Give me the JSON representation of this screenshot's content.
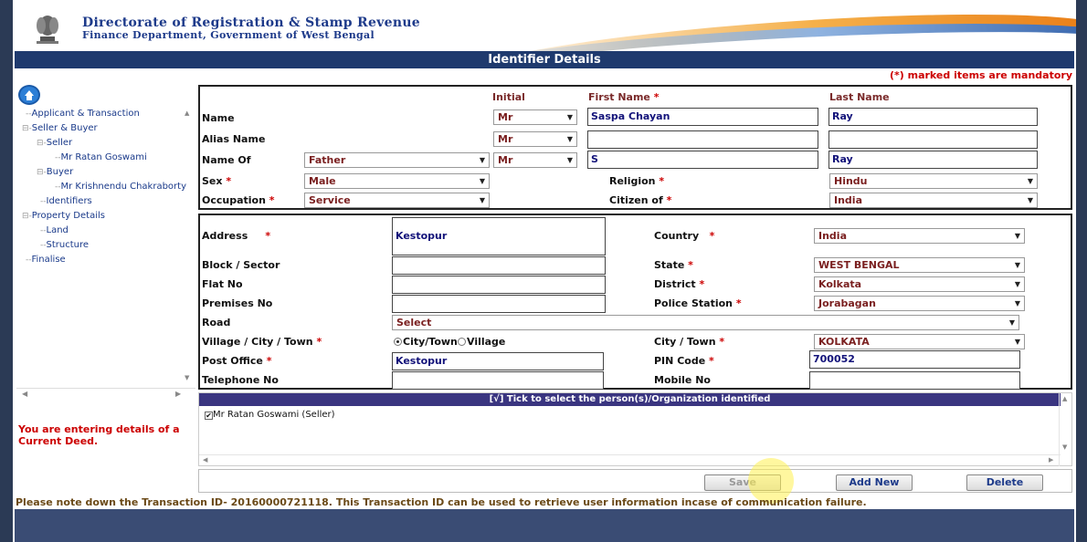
{
  "header": {
    "title": "Directorate of Registration & Stamp Revenue",
    "subtitle": "Finance Department, Government of West Bengal",
    "emblem_text": "सत्यमेव जयते"
  },
  "page_title": "Identifier Details",
  "mandatory_note": "(*) marked items are mandatory",
  "tree": [
    {
      "label": "Applicant & Transaction",
      "prefix": "--"
    },
    {
      "label": "Seller & Buyer",
      "prefix": "⊟-"
    },
    {
      "label": "Seller",
      "prefix": "⊟-"
    },
    {
      "label": "Mr Ratan Goswami",
      "prefix": "--"
    },
    {
      "label": "Buyer",
      "prefix": "⊟-"
    },
    {
      "label": "Mr Krishnendu Chakraborty",
      "prefix": "--"
    },
    {
      "label": "Identifiers",
      "prefix": "--"
    },
    {
      "label": "Property Details",
      "prefix": "⊟-"
    },
    {
      "label": "Land",
      "prefix": "--"
    },
    {
      "label": "Structure",
      "prefix": "--"
    },
    {
      "label": "Finalise",
      "prefix": "--"
    }
  ],
  "warning": "You are entering details of a Current Deed.",
  "person": {
    "col_initial": "Initial",
    "col_first": "First Name",
    "col_last": "Last Name",
    "name_label": "Name",
    "name_initial": "Mr",
    "first_name": "Saspa Chayan",
    "last_name": "Ray",
    "alias_label": "Alias Name",
    "alias_initial": "Mr",
    "alias_first": "",
    "alias_last": "",
    "nameof_label": "Name Of",
    "nameof_relation": "Father",
    "nameof_initial": "Mr",
    "nameof_first": "S",
    "nameof_last": "Ray",
    "sex_label": "Sex",
    "sex_value": "Male",
    "religion_label": "Religion",
    "religion_value": "Hindu",
    "occupation_label": "Occupation",
    "occupation_value": "Service",
    "citizen_label": "Citizen of",
    "citizen_value": "India"
  },
  "address": {
    "address_label": "Address",
    "address_value": "Kestopur",
    "country_label": "Country",
    "country_value": "India",
    "block_label": "Block / Sector",
    "block_value": "",
    "state_label": "State",
    "state_value": "WEST BENGAL",
    "flat_label": "Flat No",
    "flat_value": "",
    "district_label": "District",
    "district_value": "Kolkata",
    "premises_label": "Premises No",
    "premises_value": "",
    "police_label": "Police Station",
    "police_value": "Jorabagan",
    "road_label": "Road",
    "road_value": "Select",
    "village_label": "Village / City / Town",
    "radio_city": "City/Town",
    "radio_village": "Village",
    "city_label": "City / Town",
    "city_value": "KOLKATA",
    "post_label": "Post Office",
    "post_value": "Kestopur",
    "pin_label": "PIN Code",
    "pin_value": "700052",
    "tel_label": "Telephone No",
    "tel_value": "",
    "mobile_label": "Mobile No",
    "mobile_value": ""
  },
  "identified": {
    "header": "[√] Tick to select the person(s)/Organization identified",
    "items": [
      "Mr Ratan Goswami (Seller)"
    ]
  },
  "buttons": {
    "save": "Save",
    "add_new": "Add New",
    "delete": "Delete"
  },
  "transaction_note": "Please note down the Transaction ID- 20160000721118. This Transaction ID can be used to retrieve user information incase of communication failure.",
  "required_mark": "*",
  "caret": "▼",
  "check": "✔",
  "colors": {
    "title_bar": "#1f3a6e",
    "list_header": "#3a3580",
    "required": "#cc0000"
  }
}
